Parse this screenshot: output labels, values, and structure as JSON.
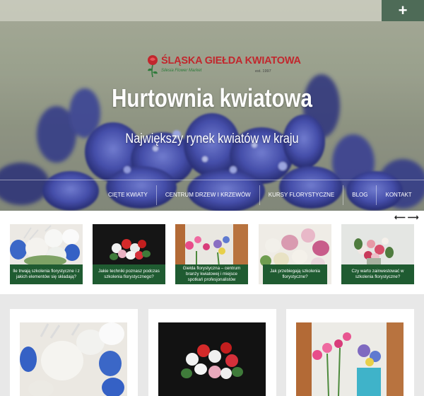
{
  "header": {
    "plus_label": "+",
    "logo_title": "ŚLĄSKA GIEŁDA KWIATOWA",
    "logo_tagline": "Silesia Flower Market",
    "logo_since": "est. 1997",
    "title": "Hurtownia kwiatowa",
    "subtitle": "Największy rynek kwiatów w kraju"
  },
  "nav": {
    "items": [
      {
        "label": "CIĘTE KWIATY"
      },
      {
        "label": "CENTRUM DRZEW I KRZEWÓW"
      },
      {
        "label": "KURSY FLORYSTYCZNE"
      },
      {
        "label": "BLOG"
      },
      {
        "label": "KONTAKT"
      }
    ]
  },
  "slider": {
    "prev_label": "⟵",
    "next_label": "⟶",
    "slides": [
      {
        "caption": "Ile trwają szkolenia florystyczne i z jakich elementów się składają?"
      },
      {
        "caption": "Jakie techniki poznasz podczas szkolenia florystycznego?"
      },
      {
        "caption": "Giełda florystyczna – centrum branży kwiatowej i miejsce spotkań profesjonalistów"
      },
      {
        "caption": "Jak przebiegają szkolenia florystyczne?"
      },
      {
        "caption": "Czy warto zainwestować w szkolenia florystyczne?"
      }
    ]
  },
  "colors": {
    "accent_green": "#1f5b31",
    "plus_button": "#4e6b57",
    "logo_red": "#c1272d"
  },
  "icons": {
    "plus": "plus-icon",
    "arrow_left": "arrow-left-icon",
    "arrow_right": "arrow-right-icon",
    "logo": "rose-logo-icon"
  }
}
